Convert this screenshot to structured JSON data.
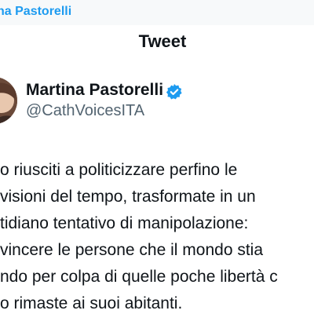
{
  "topbar": {
    "name_fragment": "na Pastorelli"
  },
  "page": {
    "title": "Tweet"
  },
  "author": {
    "display_name": "Martina Pastorelli",
    "handle": "@CathVoicesITA",
    "verified_icon": "verified-badge-icon"
  },
  "tweet": {
    "lines": [
      "o riusciti a politicizzare perfino le",
      "visioni del tempo, trasformate in un",
      "tidiano tentativo di manipolazione:",
      "vincere le persone che il mondo stia",
      "ndo per colpa di quelle poche libertà c",
      "o rimaste ai suoi abitanti."
    ]
  },
  "colors": {
    "accent": "#1d9bf0",
    "text": "#0f1419",
    "muted": "#536471",
    "background": "#ffffff"
  }
}
